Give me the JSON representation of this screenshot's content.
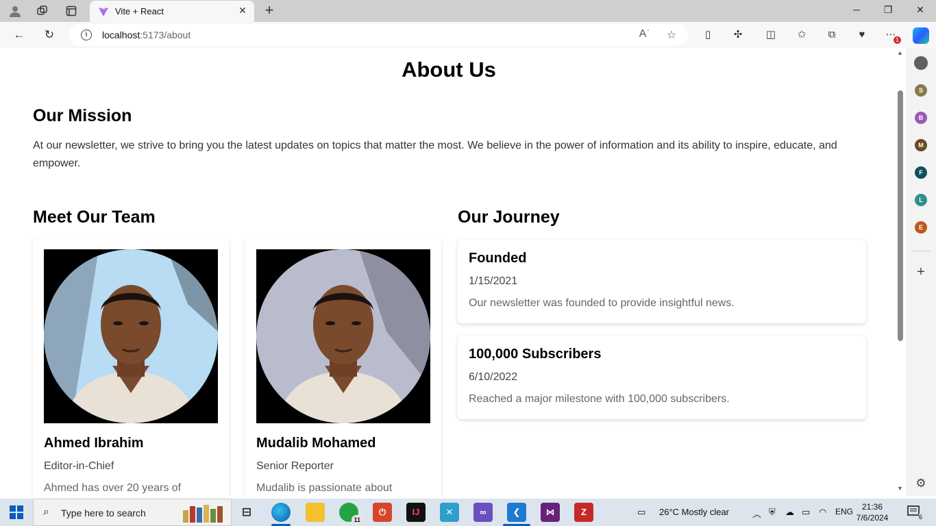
{
  "browser": {
    "tab_title": "Vite + React",
    "url_host": "localhost",
    "url_path": ":5173/about",
    "notification_badge": "1"
  },
  "page": {
    "title": "About Us",
    "mission": {
      "heading": "Our Mission",
      "text": "At our newsletter, we strive to bring you the latest updates on topics that matter the most. We believe in the power of information and its ability to inspire, educate, and empower."
    },
    "team": {
      "heading": "Meet Our Team",
      "members": [
        {
          "name": "Ahmed Ibrahim",
          "role": "Editor-in-Chief",
          "bio": "Ahmed has over 20 years of"
        },
        {
          "name": "Mudalib Mohamed",
          "role": "Senior Reporter",
          "bio": "Mudalib is passionate about"
        }
      ]
    },
    "journey": {
      "heading": "Our Journey",
      "events": [
        {
          "title": "Founded",
          "date": "1/15/2021",
          "description": "Our newsletter was founded to provide insightful news."
        },
        {
          "title": "100,000 Subscribers",
          "date": "6/10/2022",
          "description": "Reached a major milestone with 100,000 subscribers."
        }
      ]
    }
  },
  "sidebar": {
    "profiles": [
      {
        "letter": "S",
        "color": "#8a7a4a"
      },
      {
        "letter": "B",
        "color": "#9b59b6"
      },
      {
        "letter": "M",
        "color": "#6b4a1e"
      },
      {
        "letter": "F",
        "color": "#0e4f5c"
      },
      {
        "letter": "L",
        "color": "#2f8f8a"
      },
      {
        "letter": "E",
        "color": "#c0571f"
      }
    ]
  },
  "taskbar": {
    "search_placeholder": "Type here to search",
    "whatsapp_badge": "11",
    "weather": "26°C  Mostly clear",
    "language": "ENG",
    "time": "21:36",
    "date": "7/6/2024",
    "notification_count": "6"
  }
}
